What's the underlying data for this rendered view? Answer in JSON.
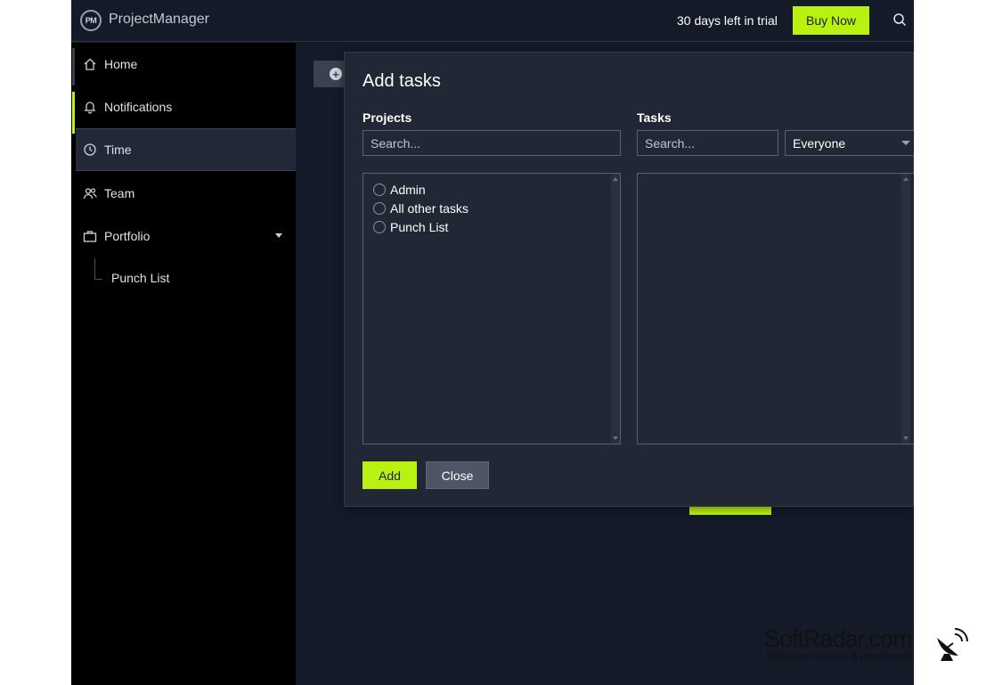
{
  "header": {
    "logo_text": "PM",
    "app_title": "ProjectManager",
    "trial_text": "30 days left in trial",
    "buy_label": "Buy Now"
  },
  "sidebar": {
    "items": [
      {
        "label": "Home",
        "icon": "home-icon"
      },
      {
        "label": "Notifications",
        "icon": "bell-icon"
      },
      {
        "label": "Time",
        "icon": "clock-icon"
      },
      {
        "label": "Team",
        "icon": "team-icon"
      },
      {
        "label": "Portfolio",
        "icon": "briefcase-icon"
      }
    ],
    "sub_items": [
      {
        "label": "Punch List"
      }
    ]
  },
  "modal": {
    "title": "Add tasks",
    "projects": {
      "label": "Projects",
      "search_placeholder": "Search...",
      "items": [
        {
          "label": "Admin"
        },
        {
          "label": "All other tasks"
        },
        {
          "label": "Punch List"
        }
      ]
    },
    "tasks": {
      "label": "Tasks",
      "search_placeholder": "Search...",
      "assignee": "Everyone"
    },
    "add_label": "Add",
    "close_label": "Close"
  },
  "watermark": {
    "title": "SoftRadar.com",
    "subtitle": "Software reviews & downloads"
  },
  "colors": {
    "accent": "#b9f211",
    "background": "#151a29",
    "sidebar": "#000000",
    "modal": "#222735"
  }
}
